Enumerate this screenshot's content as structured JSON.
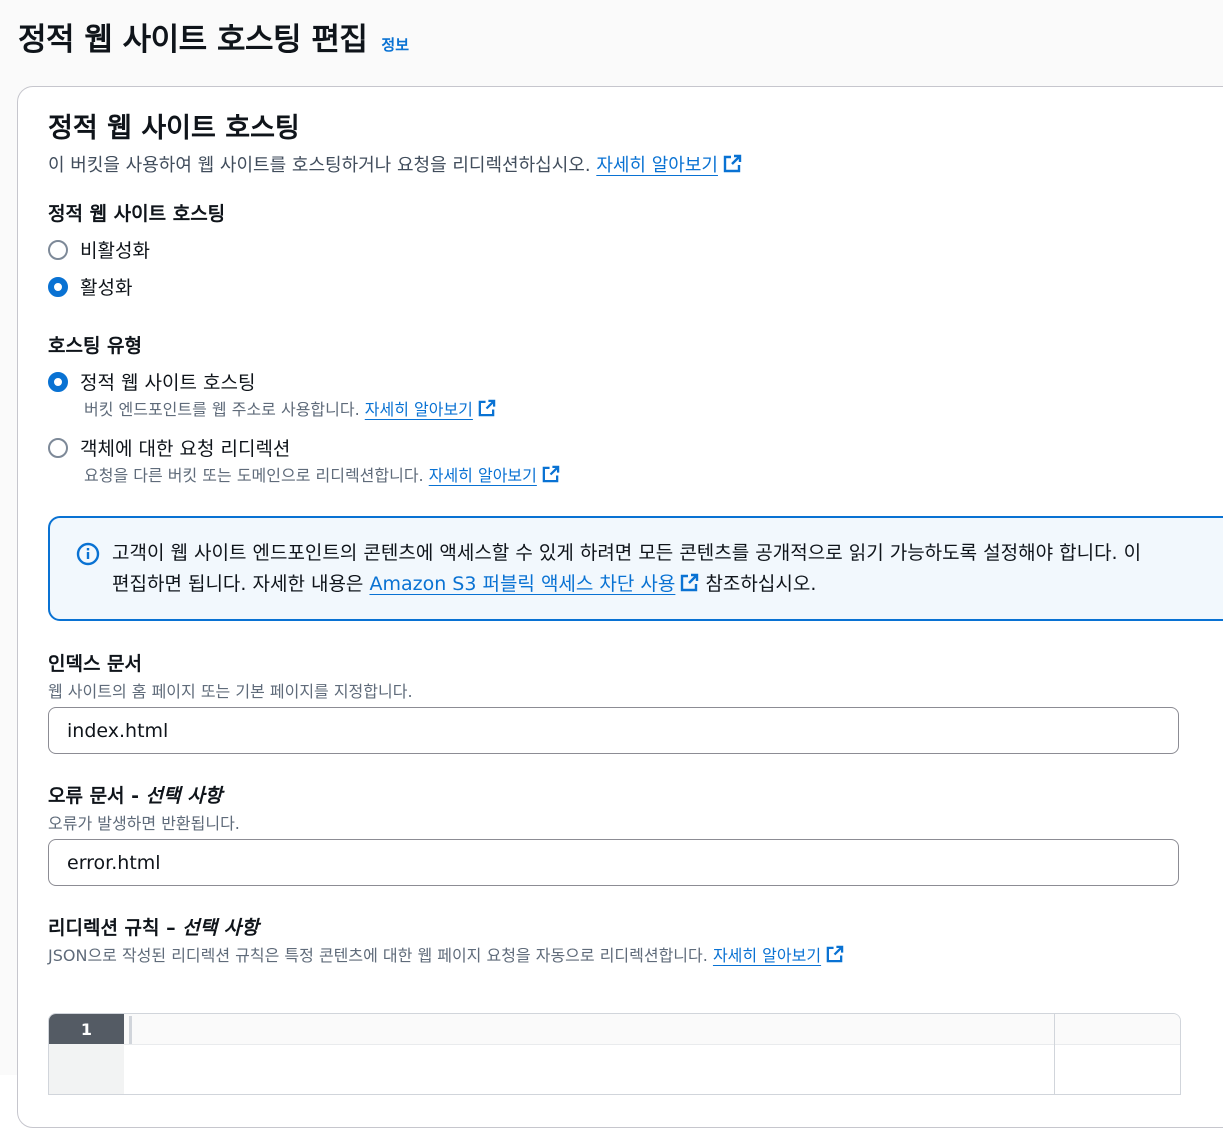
{
  "header": {
    "title": "정적 웹 사이트 호스팅 편집",
    "info": "정보"
  },
  "section": {
    "title": "정적 웹 사이트 호스팅",
    "description": "이 버킷을 사용하여 웹 사이트를 호스팅하거나 요청을 리디렉션하십시오.",
    "learn_more": "자세히 알아보기"
  },
  "hosting_toggle": {
    "label": "정적 웹 사이트 호스팅",
    "options": [
      {
        "label": "비활성화",
        "selected": false
      },
      {
        "label": "활성화",
        "selected": true
      }
    ]
  },
  "hosting_type": {
    "label": "호스팅 유형",
    "options": [
      {
        "label": "정적 웹 사이트 호스팅",
        "description": "버킷 엔드포인트를 웹 주소로 사용합니다.",
        "learn_more": "자세히 알아보기",
        "selected": true
      },
      {
        "label": "객체에 대한 요청 리디렉션",
        "description": "요청을 다른 버킷 또는 도메인으로 리디렉션합니다.",
        "learn_more": "자세히 알아보기",
        "selected": false
      }
    ]
  },
  "alert": {
    "line1": "고객이 웹 사이트 엔드포인트의 콘텐츠에 액세스할 수 있게 하려면 모든 콘텐츠를 공개적으로 읽기 가능하도록 설정해야 합니다. 이",
    "line2_prefix": "편집하면 됩니다. 자세한 내용은",
    "link": "Amazon S3 퍼블릭 액세스 차단 사용",
    "line2_suffix": "참조하십시오."
  },
  "index_document": {
    "label": "인덱스 문서",
    "description": "웹 사이트의 홈 페이지 또는 기본 페이지를 지정합니다.",
    "value": "index.html"
  },
  "error_document": {
    "label": "오류 문서 - ",
    "optional": "선택 사항",
    "description": "오류가 발생하면 반환됩니다.",
    "value": "error.html"
  },
  "redirect_rules": {
    "label": "리디렉션 규칙 – ",
    "optional": "선택 사항",
    "description": "JSON으로 작성된 리디렉션 규칙은 특정 콘텐츠에 대한 웹 페이지 요청을 자동으로 리디렉션합니다.",
    "learn_more": "자세히 알아보기",
    "line_number": "1"
  },
  "colors": {
    "accent": "#0972d3",
    "alert_bg": "#f2f8fd"
  }
}
